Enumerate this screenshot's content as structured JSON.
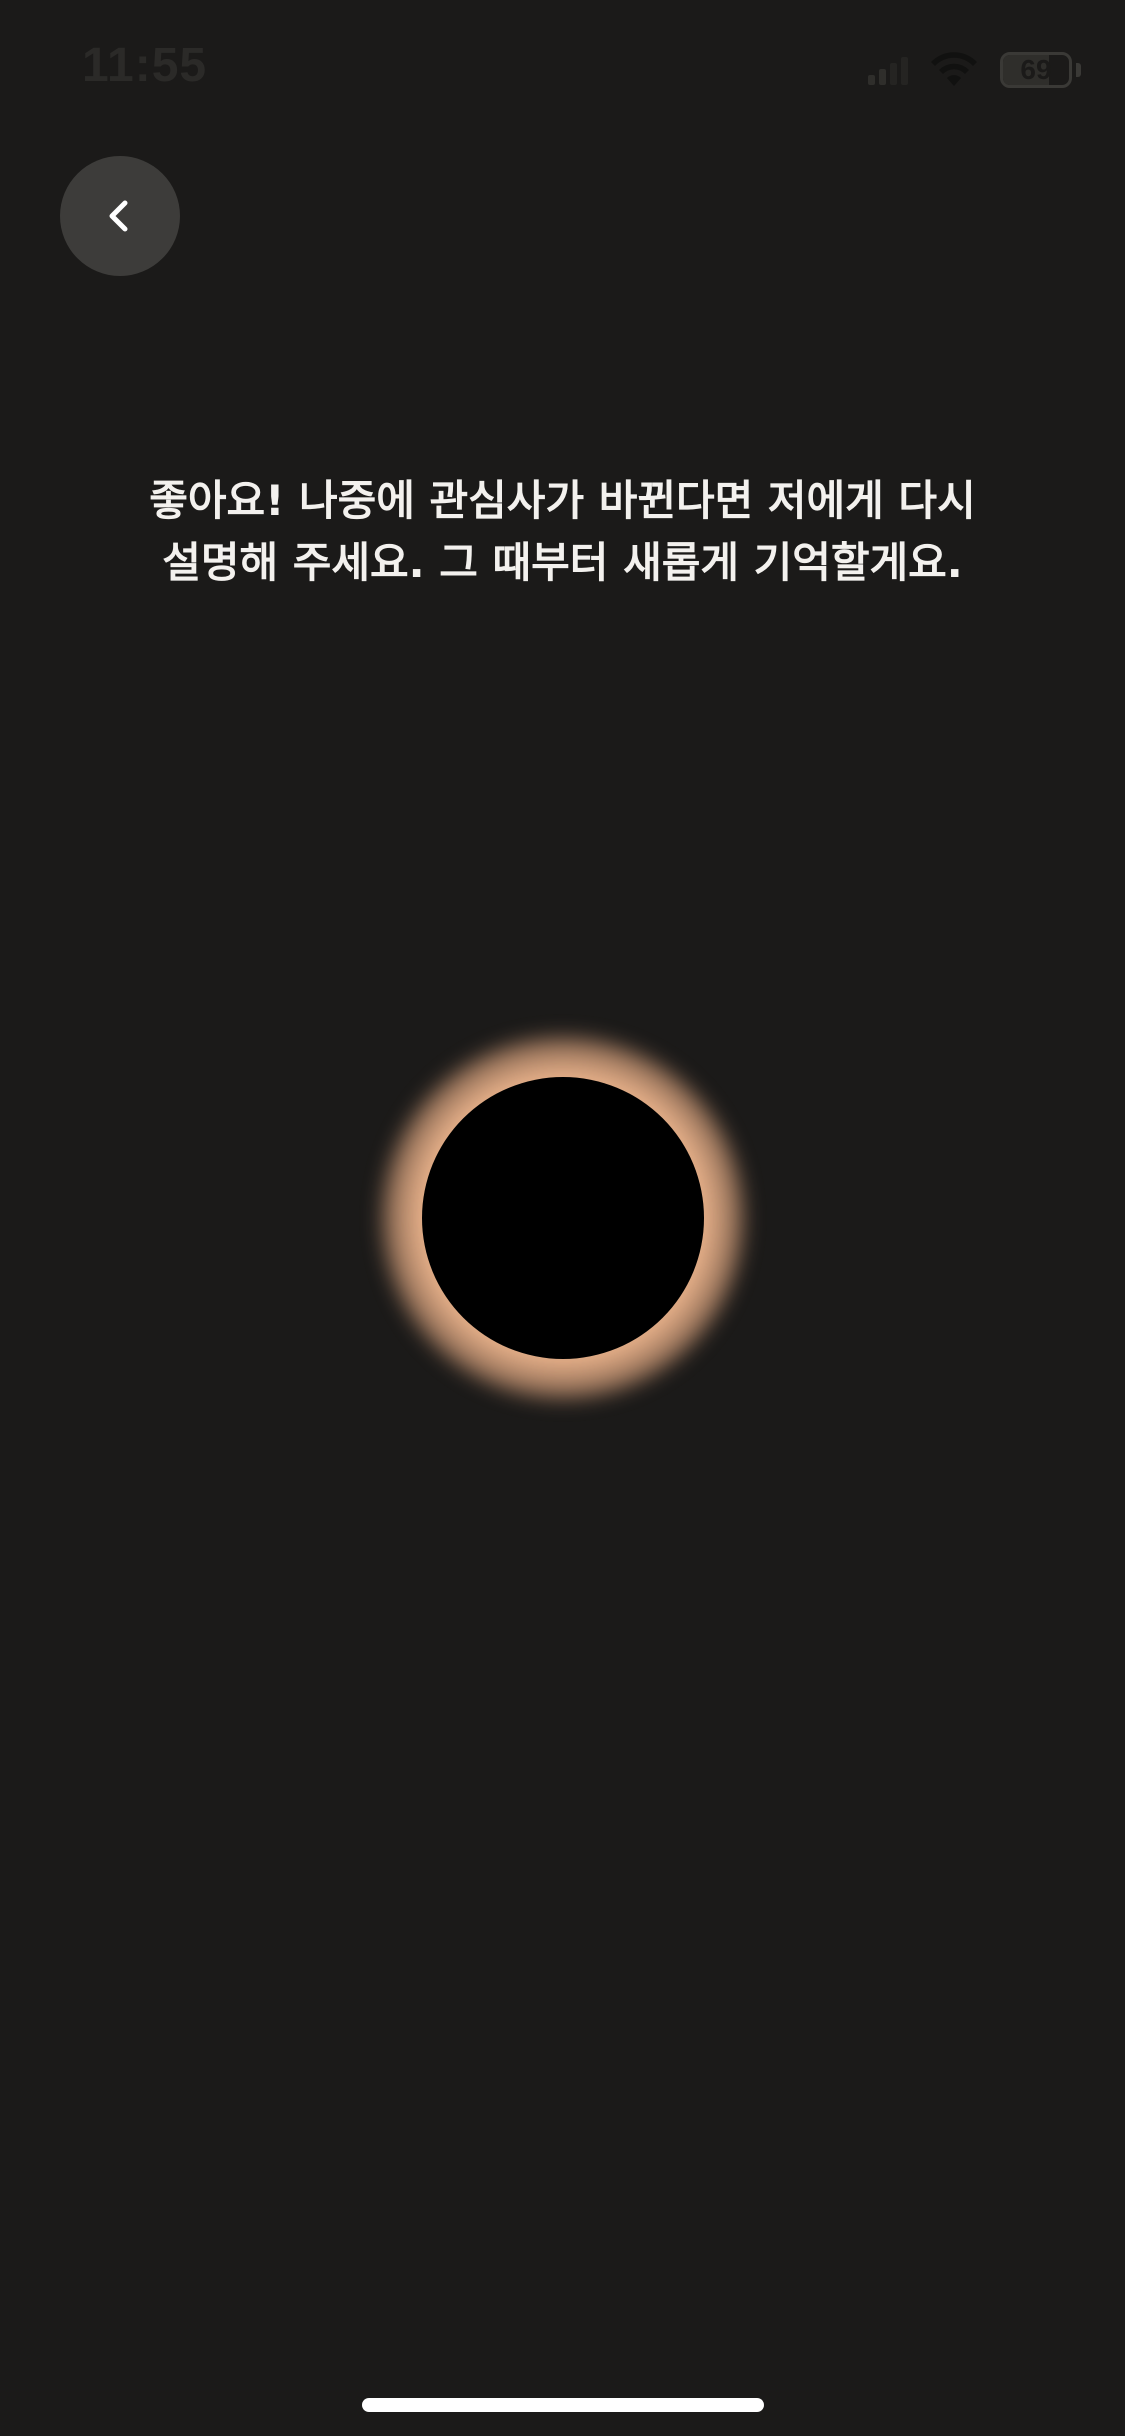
{
  "status_bar": {
    "time": "11:55",
    "battery_level": "69",
    "icons": [
      "cellular-signal-icon",
      "wifi-icon",
      "battery-icon"
    ]
  },
  "navigation": {
    "back_icon": "chevron-left-icon"
  },
  "message": {
    "line1": "좋아요! 나중에 관심사가 바뀐다면 저에게 다시",
    "line2": "설명해 주세요. 그 때부터 새롭게 기억할게요."
  },
  "visual": {
    "orb_color": "#000000",
    "glow_color": "#f0c19c",
    "background_color": "#1b1a19"
  }
}
